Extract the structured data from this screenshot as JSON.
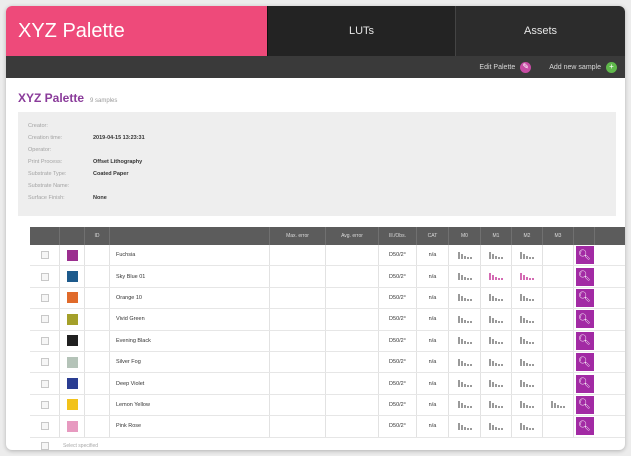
{
  "brand": {
    "title": "XYZ Palette"
  },
  "nav": {
    "tabs": [
      {
        "label": "LUTs"
      },
      {
        "label": "Assets"
      }
    ]
  },
  "toolbar": {
    "edit_label": "Edit Palette",
    "add_label": "Add new sample"
  },
  "page": {
    "title": "XYZ Palette",
    "count": "9 samples"
  },
  "meta": [
    {
      "label": "Creator:",
      "value": ""
    },
    {
      "label": "Creation time:",
      "value": "2019-04-15 13:23:31"
    },
    {
      "label": "Operator:",
      "value": ""
    },
    {
      "label": "Print Process:",
      "value": "Offset Lithography"
    },
    {
      "label": "Substrate Type:",
      "value": "Coated Paper"
    },
    {
      "label": "Substrate Name:",
      "value": ""
    },
    {
      "label": "Surface Finish:",
      "value": "None"
    }
  ],
  "table": {
    "headers": {
      "id": "ID",
      "max": "Max. error",
      "avg": "Avg. error",
      "obs": "Ill./Obs.",
      "cat": "CAT",
      "m0": "M0",
      "m1": "M1",
      "m2": "M2",
      "m3": "M3"
    },
    "rows": [
      {
        "name": "Fuchsia",
        "color": "#9b2e8f",
        "obs": "D50/2°",
        "cat": "n/a",
        "m": [
          true,
          true,
          true,
          false
        ],
        "pink": [
          false,
          false,
          false,
          false
        ]
      },
      {
        "name": "Sky Blue 01",
        "color": "#1d5a8c",
        "obs": "D50/2°",
        "cat": "n/a",
        "m": [
          true,
          true,
          true,
          false
        ],
        "pink": [
          false,
          true,
          true,
          false
        ]
      },
      {
        "name": "Orange 10",
        "color": "#e06a2a",
        "obs": "D50/2°",
        "cat": "n/a",
        "m": [
          true,
          true,
          true,
          false
        ],
        "pink": [
          false,
          false,
          false,
          false
        ]
      },
      {
        "name": "Vivid Green",
        "color": "#a4a02a",
        "obs": "D50/2°",
        "cat": "n/a",
        "m": [
          true,
          true,
          true,
          false
        ],
        "pink": [
          false,
          false,
          false,
          false
        ]
      },
      {
        "name": "Evening Black",
        "color": "#202020",
        "obs": "D50/2°",
        "cat": "n/a",
        "m": [
          true,
          true,
          true,
          false
        ],
        "pink": [
          false,
          false,
          false,
          false
        ]
      },
      {
        "name": "Silver Fog",
        "color": "#b4c3b8",
        "obs": "D50/2°",
        "cat": "n/a",
        "m": [
          true,
          true,
          true,
          false
        ],
        "pink": [
          false,
          false,
          false,
          false
        ]
      },
      {
        "name": "Deep Violet",
        "color": "#2a3d92",
        "obs": "D50/2°",
        "cat": "n/a",
        "m": [
          true,
          true,
          true,
          false
        ],
        "pink": [
          false,
          false,
          false,
          false
        ]
      },
      {
        "name": "Lemon Yellow",
        "color": "#f2c21a",
        "obs": "D50/2°",
        "cat": "n/a",
        "m": [
          true,
          true,
          true,
          true
        ],
        "pink": [
          false,
          false,
          false,
          false
        ]
      },
      {
        "name": "Pink Rose",
        "color": "#e79ac0",
        "obs": "D50/2°",
        "cat": "n/a",
        "m": [
          true,
          true,
          true,
          false
        ],
        "pink": [
          false,
          false,
          false,
          false
        ]
      }
    ],
    "footer": "Select specified"
  },
  "icons": {
    "edit": "palette-icon",
    "add": "plus-icon",
    "action": "search-icon",
    "measurement": "bar-chart-icon"
  },
  "colors": {
    "accent": "#ee4a7a",
    "action": "#a22aa4",
    "nav": "#232323"
  }
}
